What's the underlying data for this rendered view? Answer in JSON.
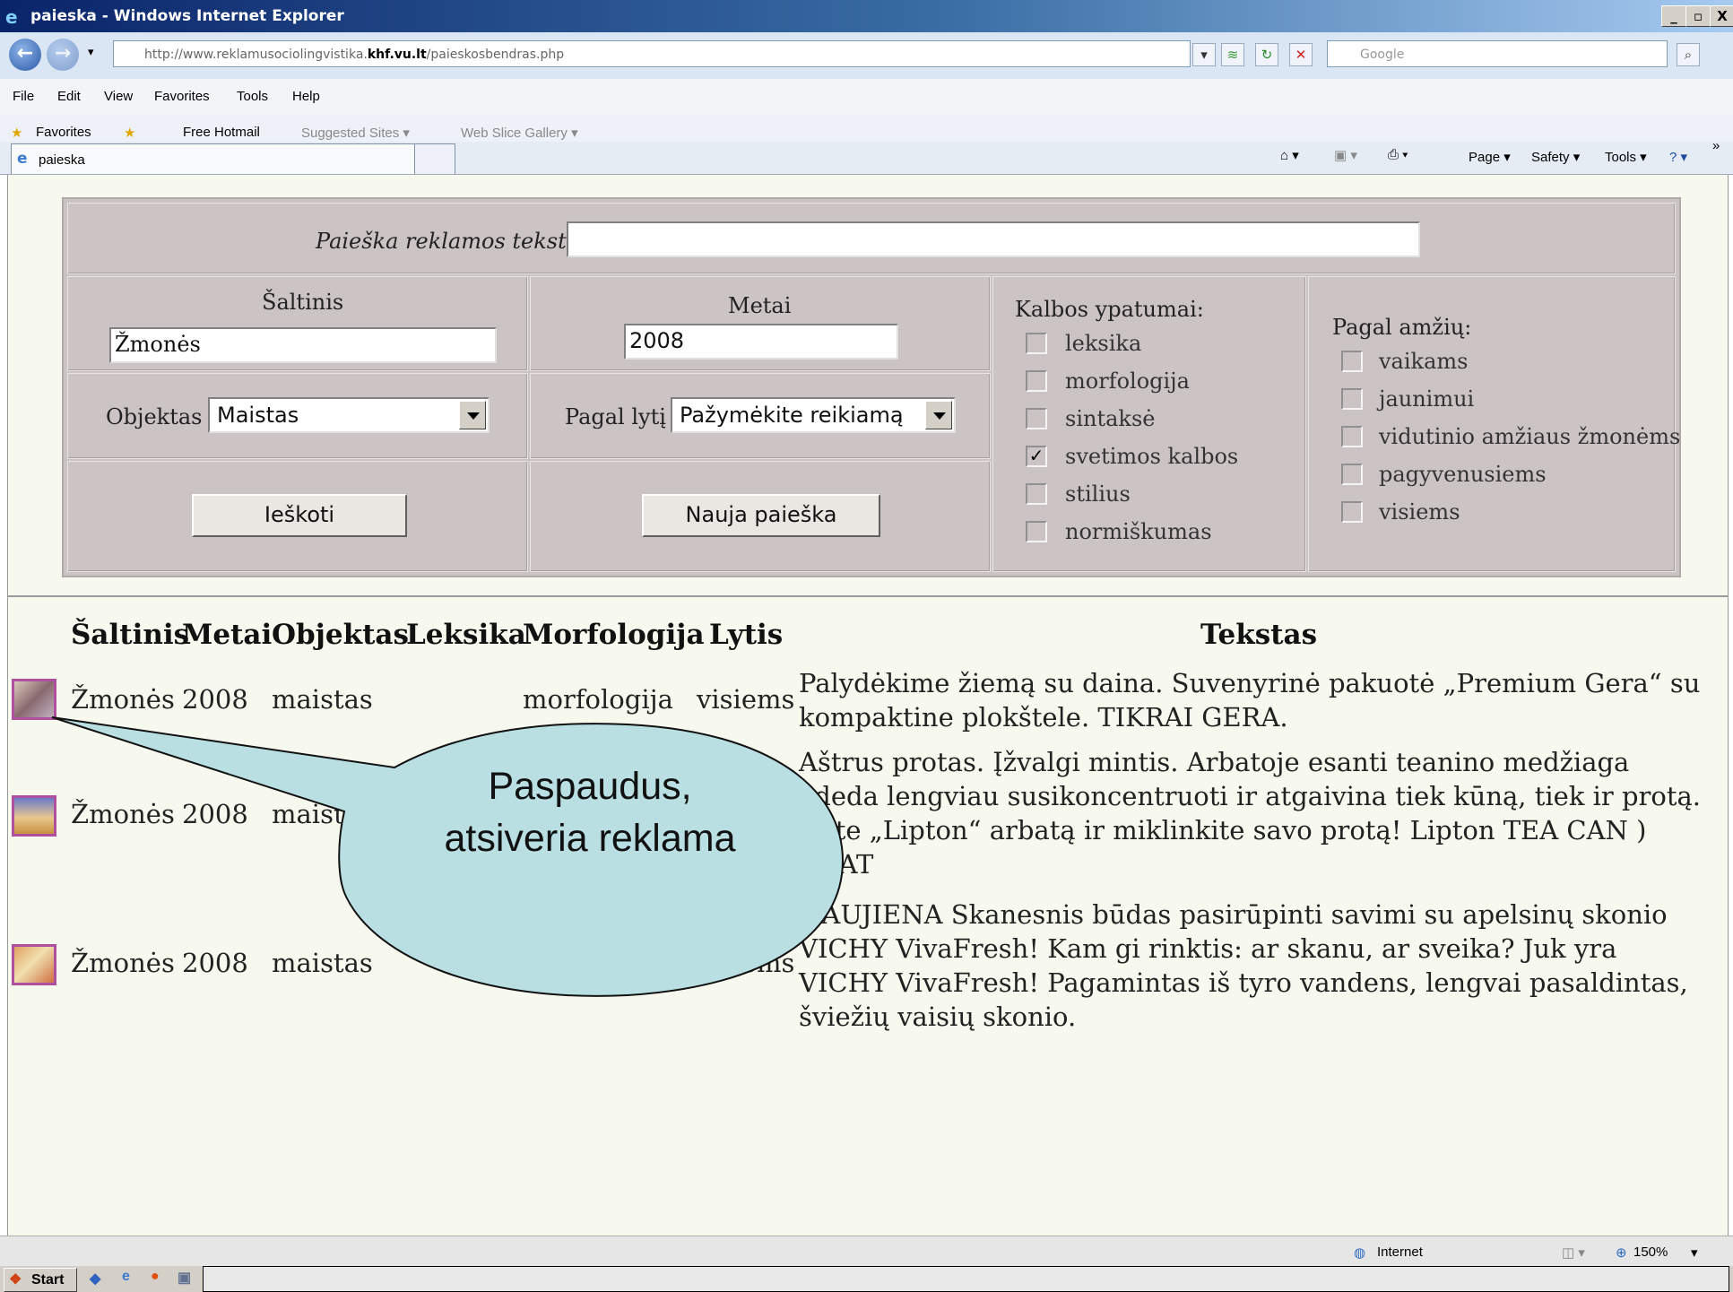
{
  "window": {
    "title": "paieska - Windows Internet Explorer",
    "controls": [
      "_",
      "▫",
      "X"
    ]
  },
  "address": {
    "url_prefix": "http://www.reklamusociolingvistika.",
    "url_domain": "khf.vu.lt",
    "url_path": "/paieskosbendras.php",
    "search_placeholder": "Google"
  },
  "menu": [
    "File",
    "Edit",
    "View",
    "Favorites",
    "Tools",
    "Help"
  ],
  "favorites_bar": {
    "favorites": "Favorites",
    "free_hotmail": "Free Hotmail",
    "suggested_sites": "Suggested Sites ▾",
    "web_slice": "Web Slice Gallery ▾"
  },
  "tab": {
    "title": "paieska"
  },
  "command_bar": [
    "Page ▾",
    "Safety ▾",
    "Tools ▾"
  ],
  "form": {
    "search_label": "Paieška reklamos tekste",
    "search_value": "",
    "source_label": "Šaltinis",
    "source_value": "Žmonės",
    "year_label": "Metai",
    "year_value": "2008",
    "object_label": "Objektas",
    "object_value": "Maistas",
    "gender_label": "Pagal lytį",
    "gender_value": "Pažymėkite reikiamą",
    "search_button": "Ieškoti",
    "new_search_button": "Nauja paieška",
    "language_title": "Kalbos ypatumai:",
    "language_options": [
      {
        "label": "leksika",
        "checked": false
      },
      {
        "label": "morfologija",
        "checked": false
      },
      {
        "label": "sintaksė",
        "checked": false
      },
      {
        "label": "svetimos kalbos",
        "checked": true
      },
      {
        "label": "stilius",
        "checked": false
      },
      {
        "label": "normiškumas",
        "checked": false
      }
    ],
    "age_title": "Pagal amžių:",
    "age_options": [
      {
        "label": "vaikams",
        "checked": false
      },
      {
        "label": "jaunimui",
        "checked": false
      },
      {
        "label": "vidutinio amžiaus žmonėms",
        "checked": false
      },
      {
        "label": "pagyvenusiems",
        "checked": false
      },
      {
        "label": "visiems",
        "checked": false
      }
    ]
  },
  "results": {
    "headers": [
      "Šaltinis",
      "Metai",
      "Objektas",
      "Leksika",
      "Morfologija",
      "Lytis",
      "Tekstas"
    ],
    "rows": [
      {
        "source": "Žmonės",
        "year": "2008",
        "object": "maistas",
        "lexis": "",
        "morphology": "morfologija",
        "gender": "visiems",
        "text": "Palydėkime žiemą su daina. Suvenyrinė pakuotė „Premium Gera“ su kompaktine plokštele. TIKRAI GERA."
      },
      {
        "source": "Žmonės",
        "year": "2008",
        "object": "maist",
        "lexis": "",
        "morphology": "",
        "gender": "",
        "text": "Aštrus protas. Įžvalgi mintis. Arbatoje esanti teanino medžiaga adeda lengviau susikoncentruoti ir atgaivina tiek kūną, tiek ir protą. rkite „Lipton“ arbatą ir miklinkite savo protą! Lipton TEA CAN ) THAT"
      },
      {
        "source": "Žmonės",
        "year": "2008",
        "object": "maistas",
        "lexis": "",
        "morphology": "morfologija",
        "gender": "visiems",
        "text": "NAUJIENA Skanesnis būdas pasirūpinti savimi su apelsinų skonio VICHY VivaFresh! Kam gi rinktis: ar skanu, ar sveika? Juk yra VICHY VivaFresh! Pagamintas iš tyro vandens, lengvai pasaldintas, šviežių vaisių skonio."
      }
    ]
  },
  "callout": {
    "line1": "Paspaudus,",
    "line2": "atsiveria reklama"
  },
  "status": {
    "zone": "Internet",
    "zoom": "150%"
  },
  "taskbar": {
    "start": "Start"
  }
}
